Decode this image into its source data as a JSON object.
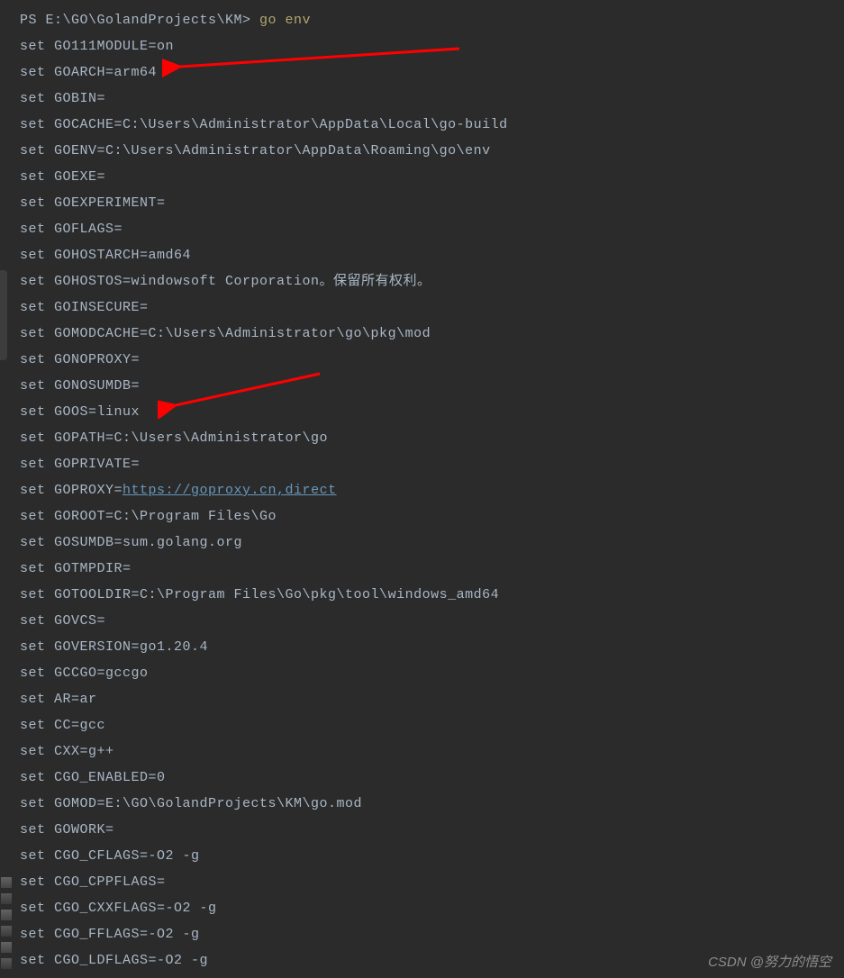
{
  "prompt": {
    "ps": "PS E:\\GO\\GolandProjects\\KM> ",
    "cmd": "go env"
  },
  "lines": [
    "set GO111MODULE=on",
    "set GOARCH=arm64",
    "set GOBIN=",
    "set GOCACHE=C:\\Users\\Administrator\\AppData\\Local\\go-build",
    "set GOENV=C:\\Users\\Administrator\\AppData\\Roaming\\go\\env",
    "set GOEXE=",
    "set GOEXPERIMENT=",
    "set GOFLAGS=",
    "set GOHOSTARCH=amd64",
    "set GOHOSTOS=windowsoft Corporation。保留所有权利。",
    "set GOINSECURE=",
    "set GOMODCACHE=C:\\Users\\Administrator\\go\\pkg\\mod",
    "set GONOPROXY=",
    "set GONOSUMDB=",
    "set GOOS=linux",
    "set GOPATH=C:\\Users\\Administrator\\go",
    "set GOPRIVATE="
  ],
  "proxy_line": {
    "prefix": "set GOPROXY=",
    "url": "https://goproxy.cn,direct"
  },
  "lines_after": [
    "set GOROOT=C:\\Program Files\\Go",
    "set GOSUMDB=sum.golang.org",
    "set GOTMPDIR=",
    "set GOTOOLDIR=C:\\Program Files\\Go\\pkg\\tool\\windows_amd64",
    "set GOVCS=",
    "set GOVERSION=go1.20.4",
    "set GCCGO=gccgo",
    "set AR=ar",
    "set CC=gcc",
    "set CXX=g++",
    "set CGO_ENABLED=0",
    "set GOMOD=E:\\GO\\GolandProjects\\KM\\go.mod",
    "set GOWORK=",
    "set CGO_CFLAGS=-O2 -g",
    "set CGO_CPPFLAGS=",
    "set CGO_CXXFLAGS=-O2 -g",
    "set CGO_FFLAGS=-O2 -g",
    "set CGO_LDFLAGS=-O2 -g"
  ],
  "watermark": "CSDN @努力的悟空"
}
